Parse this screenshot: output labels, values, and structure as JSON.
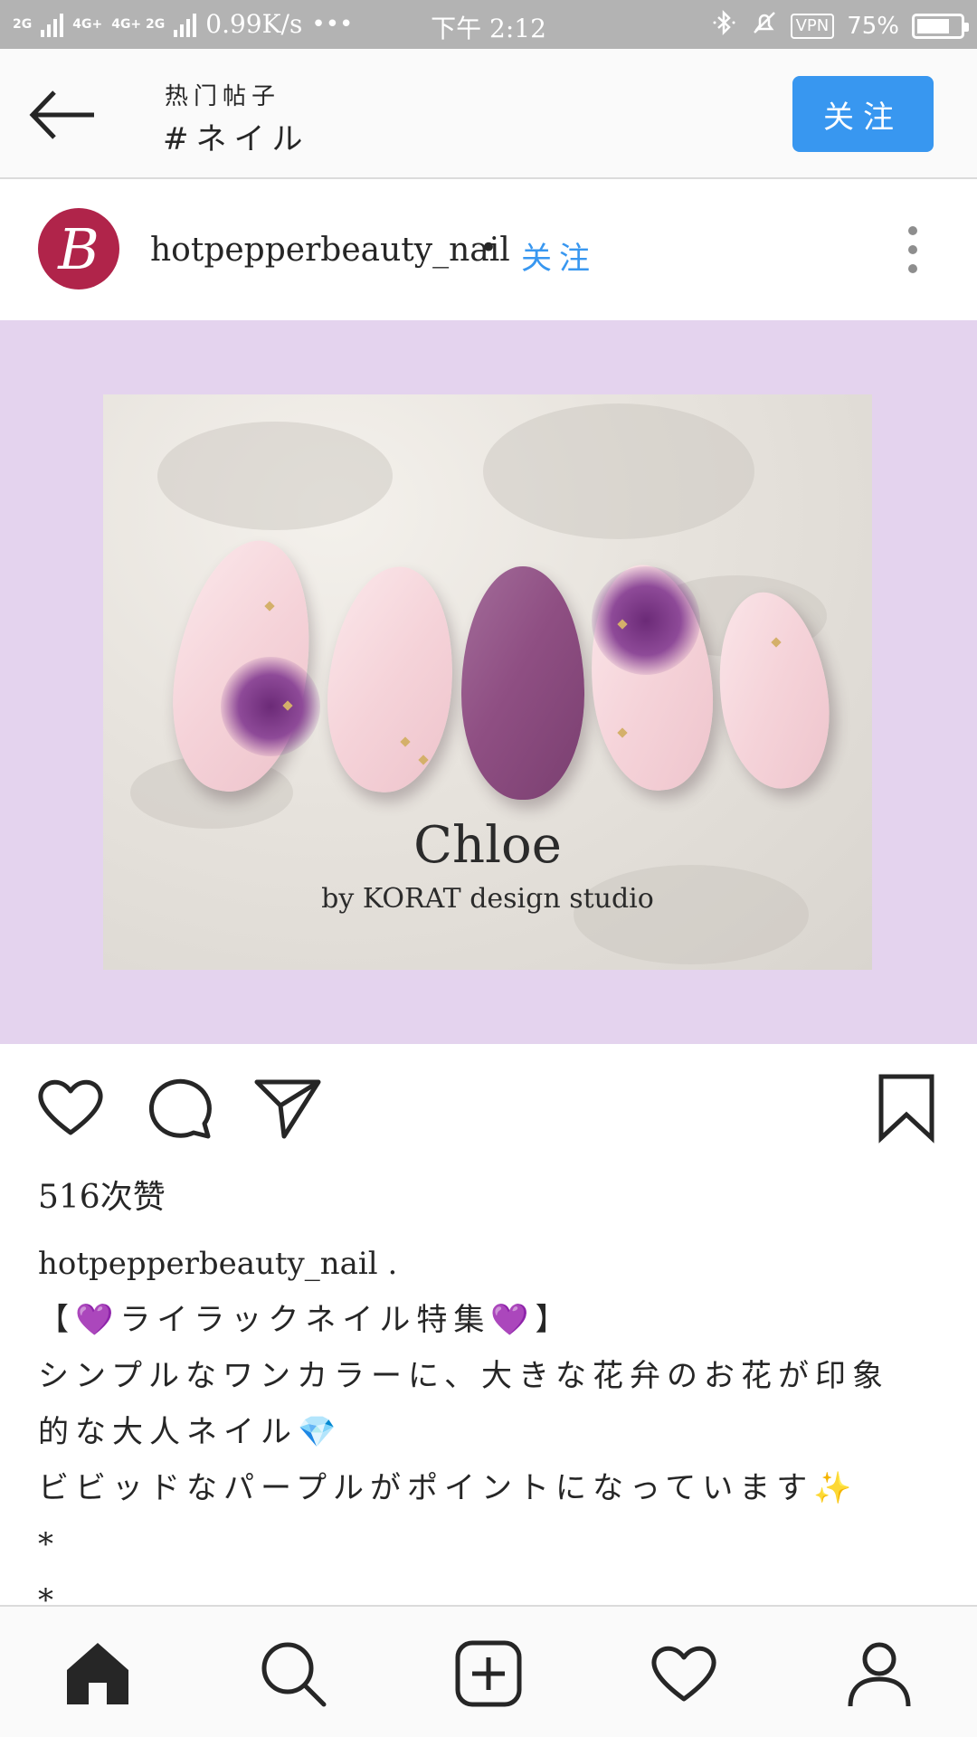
{
  "status_bar": {
    "network_left": "2G",
    "network_mid": "4G+",
    "network_mid2": "4G+ 2G",
    "speed": "0.99K/s",
    "more": "•••",
    "time": "下午 2:12",
    "vpn": "VPN",
    "battery": "75%",
    "battery_level": 0.75
  },
  "header": {
    "subtitle": "热门帖子",
    "title": "#ネイル",
    "follow_label": "关注"
  },
  "post": {
    "username": "hotpepperbeauty_nail",
    "avatar_letter": "B",
    "separator": "•",
    "follow_label": "关注",
    "image": {
      "title": "Chloe",
      "subtitle": "by KORAT design studio"
    },
    "likes": "516次赞",
    "caption": {
      "username": "hotpepperbeauty_nail .",
      "lines": [
        "【💜ライラックネイル特集💜】",
        "シンプルなワンカラーに、大きな花弁のお花が印象",
        "的な大人ネイル💎",
        "ビビッドなパープルがポイントになっています✨",
        "*",
        "*"
      ]
    }
  },
  "icons": {
    "back": "arrow-left-icon",
    "like": "heart-icon",
    "comment": "comment-icon",
    "share": "send-icon",
    "save": "bookmark-icon",
    "nav": [
      "home-icon",
      "search-icon",
      "add-post-icon",
      "activity-heart-icon",
      "profile-icon"
    ]
  },
  "colors": {
    "accent": "#3897f0",
    "avatar_bg": "#b0244a",
    "image_bg": "#e4d3ee"
  }
}
